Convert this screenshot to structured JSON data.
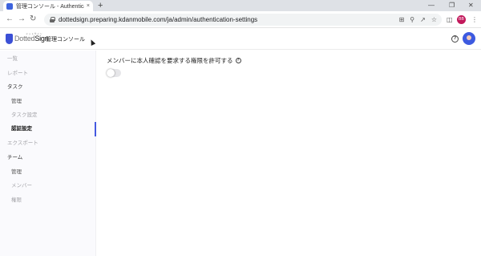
{
  "browser": {
    "tab_title": "管理コンソール - Authenticatio",
    "tab_close": "×",
    "new_tab": "+",
    "url": "dottedsign.preparing.kdanmobile.com/ja/admin/authentication-settings",
    "profile_initials": "BB"
  },
  "header": {
    "logo_text_light": "Dotted",
    "logo_text_bold": "Sign",
    "logo_ruby": "ドットサイン",
    "console_title": "管理コンソール",
    "help_glyph": "?"
  },
  "sidebar": {
    "items": [
      {
        "label": "一覧",
        "state": "muted"
      },
      {
        "label": "レポート",
        "state": "muted"
      },
      {
        "label": "タスク",
        "state": "section"
      },
      {
        "label": "管理",
        "state": "normal"
      },
      {
        "label": "タスク設定",
        "state": "muted"
      },
      {
        "label": "認証設定",
        "state": "active"
      },
      {
        "label": "エクスポート",
        "state": "muted"
      },
      {
        "label": "チーム",
        "state": "section"
      },
      {
        "label": "管理",
        "state": "normal"
      },
      {
        "label": "メンバー",
        "state": "muted"
      },
      {
        "label": "権限",
        "state": "muted"
      }
    ]
  },
  "main": {
    "setting_label": "メンバーに本人確認を要求する権限を許可する",
    "info_glyph": "?",
    "toggle_on": false
  },
  "colors": {
    "accent": "#4459e0",
    "sidebar_bg": "#fafafd",
    "profile_badge": "#c2185b"
  },
  "icons": [
    "back-arrow-icon",
    "forward-arrow-icon",
    "reload-icon",
    "lock-icon",
    "install-icon",
    "zoom-icon",
    "share-icon",
    "star-icon",
    "sidebar-icon",
    "menu-dots-icon",
    "help-icon",
    "info-icon"
  ]
}
